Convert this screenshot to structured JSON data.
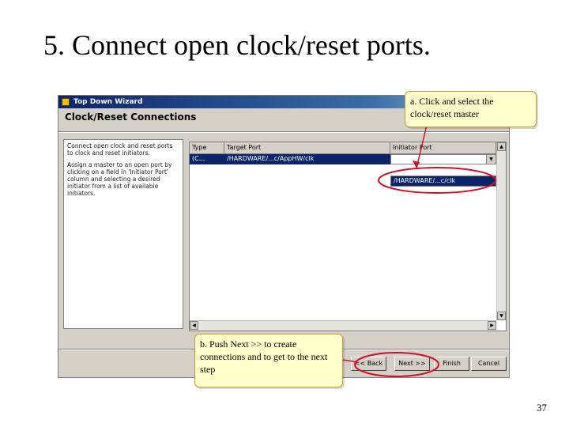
{
  "slide": {
    "title": "5. Connect open clock/reset ports.",
    "page_number": "37"
  },
  "window": {
    "title": "Top Down Wizard",
    "page_heading": "Clock/Reset Connections"
  },
  "help": {
    "paragraph1": "Connect open clock and reset ports to clock and reset initiators.",
    "paragraph2": "Assign a master to an open port by clicking on a field in 'Initiator Port' column and selecting a desired initiator from a list of available initiators."
  },
  "table": {
    "headers": {
      "type": "Type",
      "target_port": "Target Port",
      "initiator_port": "Initiator Port"
    },
    "rows": [
      {
        "type": "(C...",
        "target_port": "/HARDWARE/...c/AppHW/clk",
        "initiator_port": ""
      }
    ],
    "dropdown_option": "/HARDWARE/...c/clk"
  },
  "buttons": {
    "back": "<< Back",
    "next": "Next >>",
    "finish": "Finish",
    "cancel": "Cancel"
  },
  "callouts": {
    "a": "a. Click and select the clock/reset master",
    "b": "b. Push Next >> to create connections  and to get to the next step"
  },
  "colors": {
    "highlight_ring": "#d0102a",
    "callout_fill": "#ffffcc",
    "selection": "#0a246a"
  },
  "icons": {
    "combo_arrow": "chevron-down-icon",
    "scroll_up": "arrow-up-icon",
    "scroll_down": "arrow-down-icon"
  }
}
